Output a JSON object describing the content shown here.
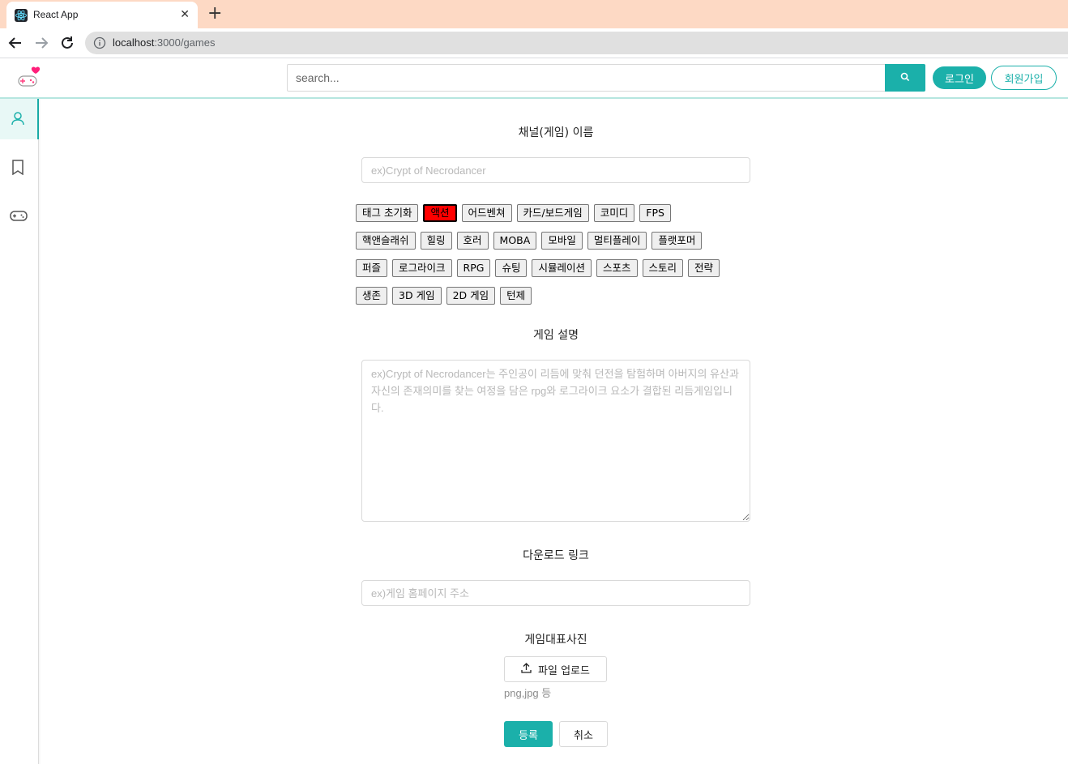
{
  "browser": {
    "tab_title": "React App",
    "close_glyph": "✕",
    "new_tab_glyph": "+",
    "url_host": "localhost",
    "url_rest": ":3000/games"
  },
  "header": {
    "search_placeholder": "search...",
    "login_label": "로그인",
    "signup_label": "회원가입",
    "accent_color": "#1bb0aa"
  },
  "sidebar": {
    "items": [
      {
        "icon": "user-icon",
        "active": true
      },
      {
        "icon": "bookmark-icon",
        "active": false
      },
      {
        "icon": "gamepad-icon",
        "active": false
      }
    ]
  },
  "form": {
    "channel_name_label": "채널(게임) 이름",
    "channel_name_placeholder": "ex)Crypt of Necrodancer",
    "tags": [
      [
        "태그 초기화",
        "액션",
        "어드벤쳐",
        "카드/보드게임",
        "코미디",
        "FPS"
      ],
      [
        "핵앤슬래쉬",
        "힐링",
        "호러",
        "MOBA",
        "모바일",
        "멀티플레이",
        "플랫포머"
      ],
      [
        "퍼즐",
        "로그라이크",
        "RPG",
        "슈팅",
        "시뮬레이션",
        "스포츠",
        "스토리",
        "전략"
      ],
      [
        "생존",
        "3D 게임",
        "2D 게임",
        "턴제"
      ]
    ],
    "selected_tag": "액션",
    "description_label": "게임 설명",
    "description_placeholder": "ex)Crypt of Necrodancer는 주인공이 리듬에 맞춰 던전을 탐험하며 아버지의 유산과 자신의 존재의미를 찾는 여정을 담은 rpg와 로그라이크 요소가 결합된 리듬게임입니다.",
    "download_label": "다운로드 링크",
    "download_placeholder": "ex)게임 홈페이지 주소",
    "image_label": "게임대표사진",
    "upload_label": "파일 업로드",
    "upload_hint": "png,jpg 등",
    "submit_label": "등록",
    "cancel_label": "취소"
  }
}
